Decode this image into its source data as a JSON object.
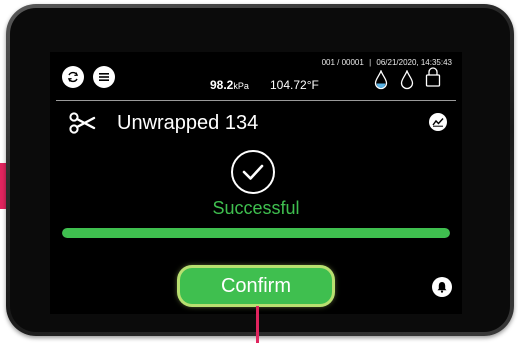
{
  "header": {
    "batch": "001 / 00001",
    "separator": "|",
    "datetime": "06/21/2020, 14:35:43",
    "pressure_value": "98.2",
    "pressure_unit": "kPa",
    "temperature": "104.72°F"
  },
  "cycle": {
    "title": "Unwrapped 134",
    "status": "Successful",
    "progress_fraction": 1.0
  },
  "actions": {
    "confirm_label": "Confirm"
  },
  "icons": {
    "left_1": "cycle-refresh-icon",
    "left_2": "menu-icon",
    "right_1": "water-drop-filled-icon",
    "right_2": "water-drop-outline-icon",
    "right_3": "lock-icon",
    "title": "scissors-icon",
    "chart": "chart-icon",
    "status": "check-icon",
    "bell": "bell-icon"
  },
  "colors": {
    "success": "#3fbf4f",
    "accent": "#e0245e",
    "screen_bg": "#000000"
  }
}
